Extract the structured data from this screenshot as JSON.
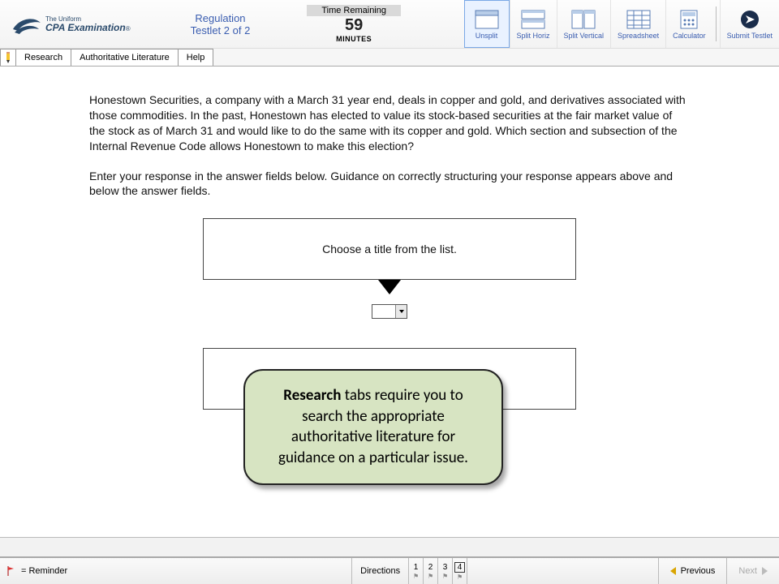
{
  "logo": {
    "line1": "The Uniform",
    "line2": "CPA Examination",
    "reg": "®"
  },
  "exam": {
    "section": "Regulation",
    "testlet": "Testlet 2 of 2"
  },
  "timer": {
    "label": "Time Remaining",
    "value": "59",
    "unit": "MINUTES"
  },
  "toolbar": {
    "unsplit": "Unsplit",
    "split_horiz": "Split Horiz",
    "split_vert": "Split Vertical",
    "spreadsheet": "Spreadsheet",
    "calculator": "Calculator",
    "submit": "Submit Testlet"
  },
  "tabs": {
    "research": "Research",
    "lit": "Authoritative Literature",
    "help": "Help"
  },
  "question": {
    "p1": "Honestown Securities, a company with a March 31 year end, deals in copper and gold, and derivatives associated with those commodities. In the past, Honestown has elected to value its stock-based securities at the fair market value of the stock as of March 31 and would like to do the same with its copper and gold. Which section and subsection of the Internal Revenue Code allows Honestown to make this election?",
    "p2": "Enter your response in the answer fields below. Guidance on correctly structuring your response appears above and below the answer fields.",
    "choose": "Choose a title from the list."
  },
  "callout": {
    "bold": "Research",
    "rest": " tabs require you to search the appropriate authoritative literature for guidance on a particular issue."
  },
  "footer": {
    "reminder": "= Reminder",
    "directions": "Directions",
    "qnums": [
      "1",
      "2",
      "3",
      "4"
    ],
    "prev": "Previous",
    "next": "Next"
  }
}
